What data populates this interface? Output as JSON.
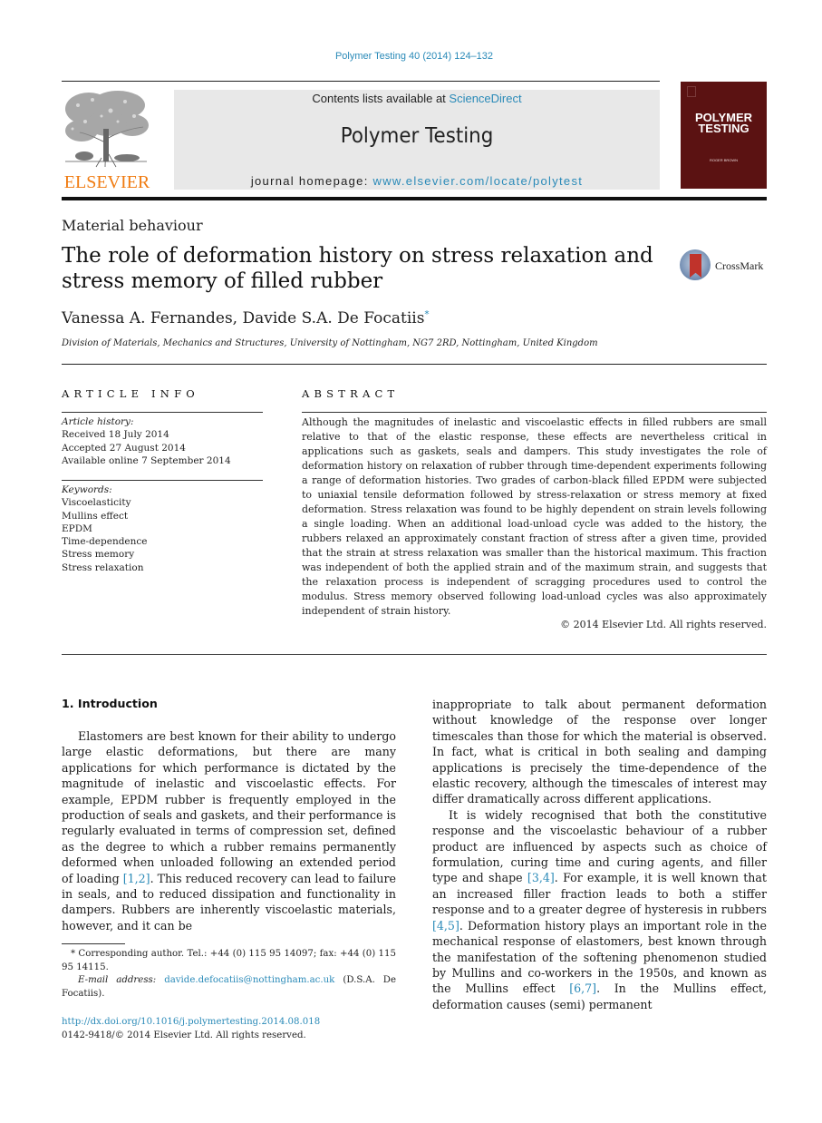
{
  "header": {
    "journal_reference": "Polymer Testing 40 (2014) 124–132",
    "contents_prefix": "Contents lists available at ",
    "contents_link": "ScienceDirect",
    "journal_name": "Polymer Testing",
    "homepage_prefix": "journal homepage: ",
    "homepage_link": "www.elsevier.com/locate/polytest",
    "publisher_wordmark": "ELSEVIER",
    "cover_title_line1": "POLYMER",
    "cover_title_line2": "TESTING",
    "cover_editor": "ROGER BROWN",
    "colors": {
      "link": "#2a8ab8",
      "elsevier_orange": "#f07c12",
      "cover": "#5b1212"
    }
  },
  "article": {
    "section": "Material behaviour",
    "title": "The role of deformation history on stress relaxation and stress memory of filled rubber",
    "crossmark_label": "CrossMark",
    "authors": "Vanessa A. Fernandes, Davide S.A. De Focatiis",
    "author_mark": "*",
    "affiliation": "Division of Materials, Mechanics and Structures, University of Nottingham, NG7 2RD, Nottingham, United Kingdom"
  },
  "article_info": {
    "heading": "ARTICLE INFO",
    "history_label": "Article history:",
    "history": [
      "Received 18 July 2014",
      "Accepted 27 August 2014",
      "Available online 7 September 2014"
    ],
    "keywords_label": "Keywords:",
    "keywords": [
      "Viscoelasticity",
      "Mullins effect",
      "EPDM",
      "Time-dependence",
      "Stress memory",
      "Stress relaxation"
    ]
  },
  "abstract": {
    "heading": "ABSTRACT",
    "text": "Although the magnitudes of inelastic and viscoelastic effects in filled rubbers are small relative to that of the elastic response, these effects are nevertheless critical in applications such as gaskets, seals and dampers. This study investigates the role of deformation history on relaxation of rubber through time-dependent experiments following a range of deformation histories. Two grades of carbon-black filled EPDM were subjected to uniaxial tensile deformation followed by stress-relaxation or stress memory at fixed deformation. Stress relaxation was found to be highly dependent on strain levels following a single loading. When an additional load-unload cycle was added to the history, the rubbers relaxed an approximately constant fraction of stress after a given time, provided that the strain at stress relaxation was smaller than the historical maximum. This fraction was independent of both the applied strain and of the maximum strain, and suggests that the relaxation process is independent of scragging procedures used to control the modulus. Stress memory observed following load-unload cycles was also approximately independent of strain history.",
    "copyright": "© 2014 Elsevier Ltd. All rights reserved."
  },
  "body": {
    "intro_heading": "1.  Introduction",
    "left_p1_a": "Elastomers are best known for their ability to undergo large elastic deformations, but there are many applications for which performance is dictated by the magnitude of inelastic and viscoelastic effects. For example, EPDM rubber is frequently employed in the production of seals and gaskets, and their performance is regularly evaluated in terms of compression set, defined as the degree to which a rubber remains permanently deformed when unloaded following an extended period of loading ",
    "left_ref1": "[1,2]",
    "left_p1_b": ". This reduced recovery can lead to failure in seals, and to reduced dissipation and functionality in dampers. Rubbers are inherently viscoelastic materials, however, and it can be",
    "right_p1": "inappropriate to talk about permanent deformation without knowledge of the response over longer timescales than those for which the material is observed. In fact, what is critical in both sealing and damping applications is precisely the time-dependence of the elastic recovery, although the timescales of interest may differ dramatically across different applications.",
    "right_p2_a": "It is widely recognised that both the constitutive response and the viscoelastic behaviour of a rubber product are influenced by aspects such as choice of formulation, curing time and curing agents, and filler type and shape ",
    "right_ref1": "[3,4]",
    "right_p2_b": ". For example, it is well known that an increased filler fraction leads to both a stiffer response and to a greater degree of hysteresis in rubbers ",
    "right_ref2": "[4,5]",
    "right_p2_c": ". Deformation history plays an important role in the mechanical response of elastomers, best known through the manifestation of the softening phenomenon studied by Mullins and co-workers in the 1950s, and known as the Mullins effect ",
    "right_ref3": "[6,7]",
    "right_p2_d": ". In the Mullins effect, deformation causes (semi) permanent"
  },
  "footnote": {
    "corresponding": "* Corresponding author. Tel.: +44 (0) 115 95 14097; fax: +44 (0) 115 95 14115.",
    "email_label": "E-mail address:",
    "email": "davide.defocatiis@nottingham.ac.uk",
    "email_suffix": " (D.S.A. De Focatiis).",
    "doi": "http://dx.doi.org/10.1016/j.polymertesting.2014.08.018",
    "issn_copyright": "0142-9418/© 2014 Elsevier Ltd. All rights reserved."
  }
}
